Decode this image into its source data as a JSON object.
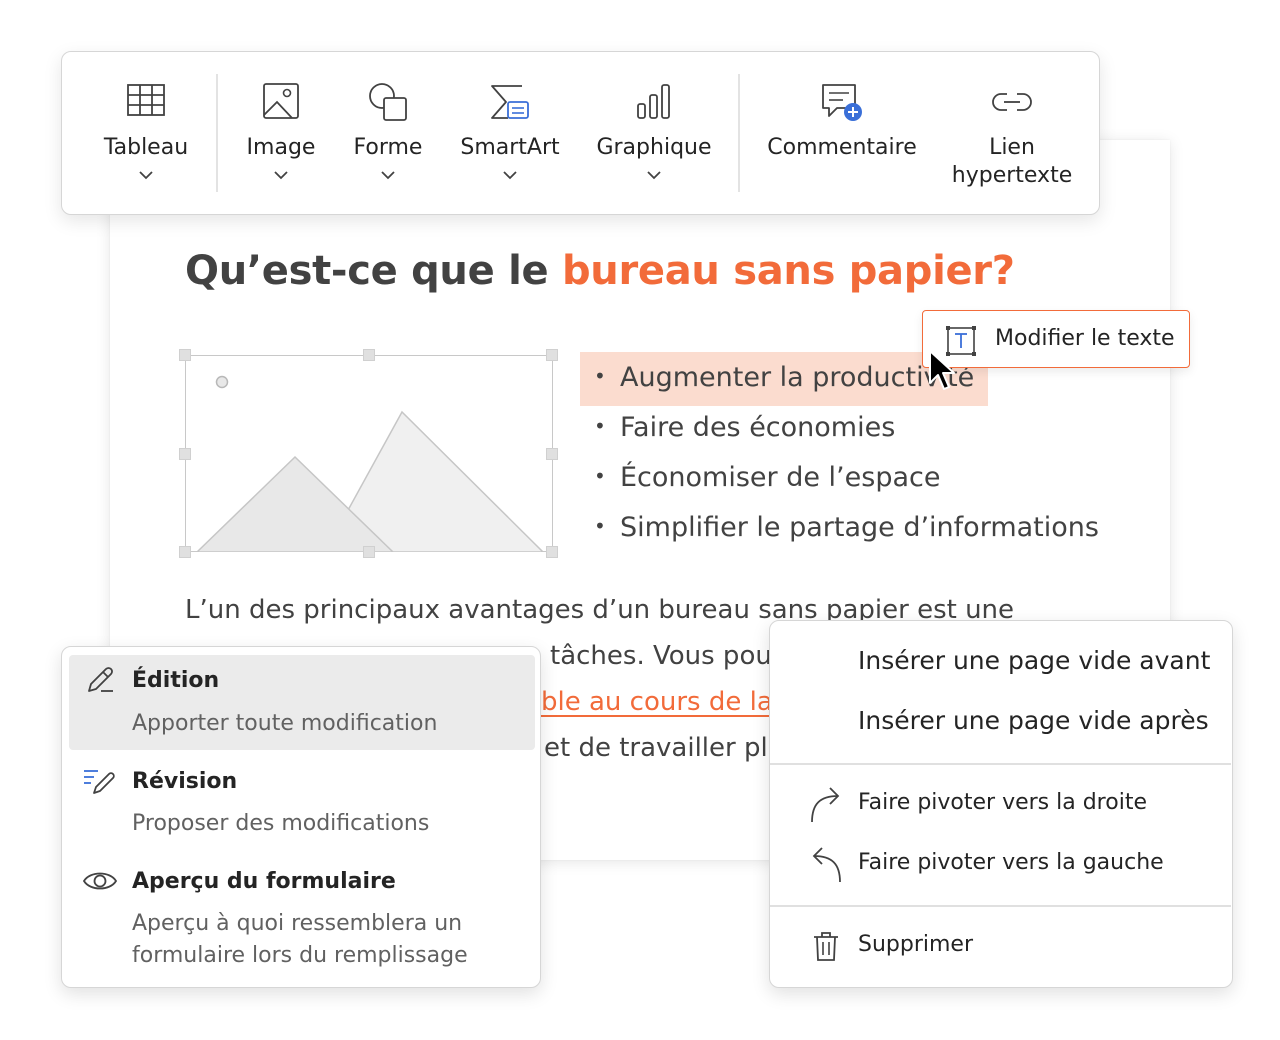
{
  "ribbon": {
    "items": [
      {
        "label": "Tableau",
        "icon": "table-icon"
      },
      {
        "label": "Image",
        "icon": "image-icon"
      },
      {
        "label": "Forme",
        "icon": "shapes-icon"
      },
      {
        "label": "SmartArt",
        "icon": "smartart-icon"
      },
      {
        "label": "Graphique",
        "icon": "chart-icon"
      },
      {
        "label": "Commentaire",
        "icon": "comment-add-icon"
      },
      {
        "label_line1": "Lien",
        "label_line2": "hypertexte",
        "icon": "link-icon"
      }
    ]
  },
  "document": {
    "heading_plain": "Qu’est-ce que le ",
    "heading_highlight": "bureau sans papier?",
    "bullets": [
      "Augmenter la productivité",
      "Faire des économies",
      "Économiser de l’espace",
      "Simplifier le partage d’informations"
    ],
    "paragraph": {
      "line1": "L’un des principaux avantages d’un bureau sans papier est une",
      "line2_fragment": "tâches. Vous pou",
      "line3_link_fragment": "ble au cours de la",
      "line4_fragment": "et de travailler plu"
    }
  },
  "tooltip": {
    "label": "Modifier le texte",
    "icon": "text-box-icon"
  },
  "mode_menu": {
    "items": [
      {
        "title": "Édition",
        "description": "Apporter toute modification",
        "icon": "pencil-icon",
        "active": true
      },
      {
        "title": "Révision",
        "description": "Proposer des modifications",
        "icon": "review-pencil-icon",
        "active": false
      },
      {
        "title": "Aperçu du formulaire",
        "description_line1": "Aperçu à quoi ressemblera un",
        "description_line2": "formulaire lors du remplissage",
        "icon": "eye-icon",
        "active": false
      }
    ]
  },
  "context_menu": {
    "items": [
      {
        "label": "Insérer une page vide avant"
      },
      {
        "label": "Insérer une page vide après"
      },
      {
        "label": "Faire pivoter vers la droite",
        "icon": "rotate-right-icon"
      },
      {
        "label": "Faire pivoter vers la gauche",
        "icon": "rotate-left-icon"
      },
      {
        "label": "Supprimer",
        "icon": "trash-icon"
      }
    ]
  },
  "colors": {
    "accent": "#f26b3a",
    "highlight_bg": "#fbdccf",
    "menu_active_bg": "#ebebeb",
    "icon_blue": "#3a6fd8"
  }
}
